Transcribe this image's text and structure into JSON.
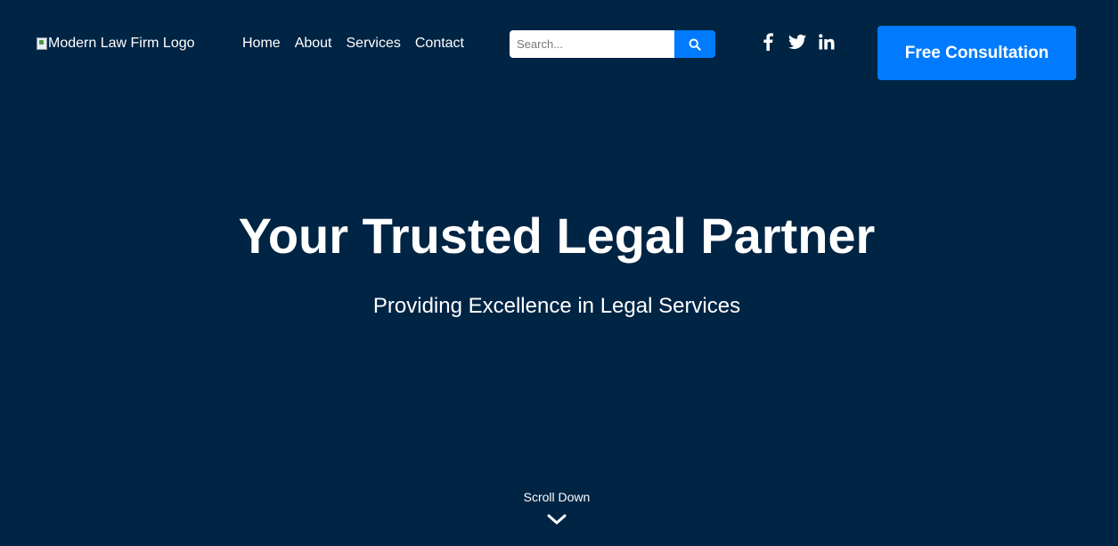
{
  "header": {
    "logo_alt": "Modern Law Firm Logo",
    "nav": [
      {
        "label": "Home"
      },
      {
        "label": "About"
      },
      {
        "label": "Services"
      },
      {
        "label": "Contact"
      }
    ],
    "search": {
      "placeholder": "Search...",
      "button_icon": "search-icon"
    },
    "social": [
      {
        "icon": "facebook-icon"
      },
      {
        "icon": "twitter-icon"
      },
      {
        "icon": "linkedin-icon"
      }
    ],
    "cta_label": "Free Consultation"
  },
  "hero": {
    "title": "Your Trusted Legal Partner",
    "subtitle": "Providing Excellence in Legal Services"
  },
  "scroll": {
    "label": "Scroll Down",
    "icon": "chevron-down-icon"
  },
  "colors": {
    "background": "#002444",
    "accent": "#007bff",
    "text": "#ffffff"
  }
}
